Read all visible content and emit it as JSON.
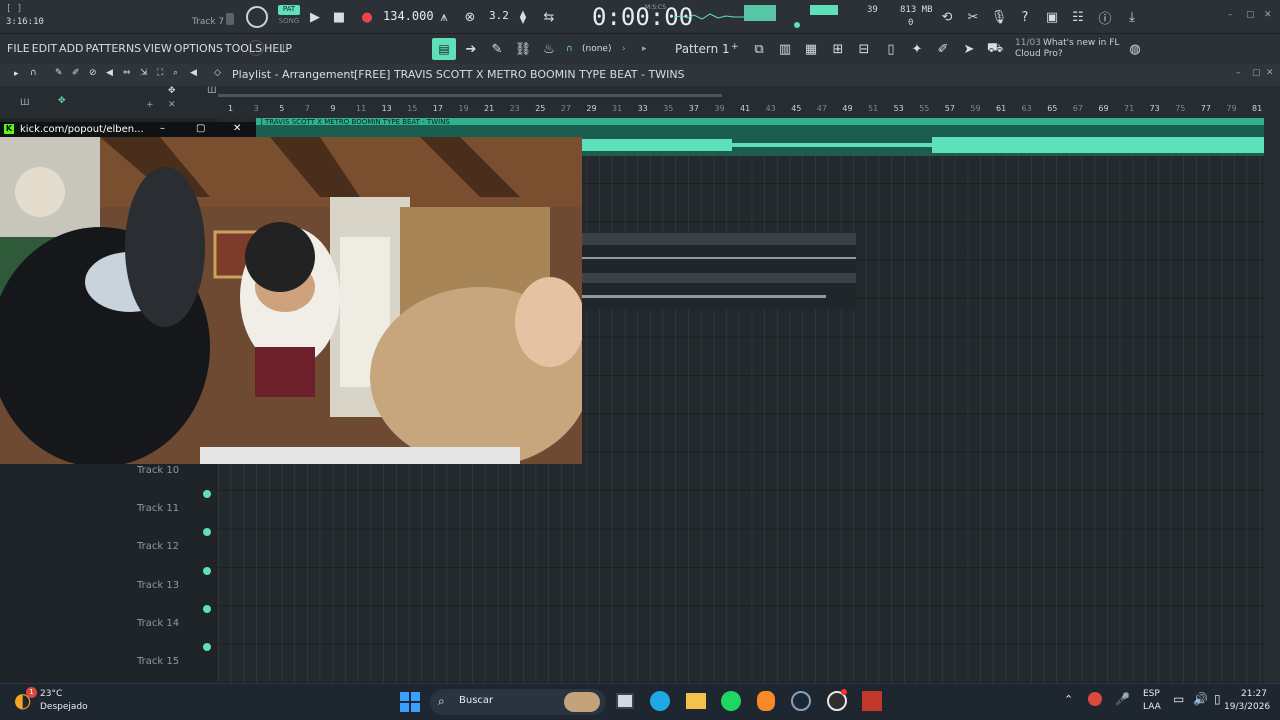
{
  "top": {
    "time_small": "3:16:10",
    "track_name": "Track 7",
    "pat_label": "PAT",
    "song_label": "SONG",
    "tempo": "134.000",
    "step_label": "3.2",
    "clock": "0:00:00",
    "clock_unit": "M:S:CS",
    "cpu": "39",
    "mem": "813 MB",
    "mem2": "0"
  },
  "menu": {
    "items": [
      "FILE",
      "EDIT",
      "ADD",
      "PATTERNS",
      "VIEW",
      "OPTIONS",
      "TOOLS",
      "HELP"
    ],
    "snap": "(none)",
    "pattern": "Pattern 1",
    "news_date": "11/03",
    "news_text": "What's new in FL Cloud Pro?"
  },
  "playlist": {
    "title": "Playlist - Arrangement",
    "project": "[FREE] TRAVIS SCOTT X METRO BOOMIN TYPE BEAT - TWINS",
    "clip_title": "] TRAVIS SCOTT X METRO BOOMIN TYPE BEAT - TWINS"
  },
  "ruler": {
    "ticks": [
      "1",
      "3",
      "5",
      "7",
      "9",
      "11",
      "13",
      "15",
      "17",
      "19",
      "21",
      "23",
      "25",
      "27",
      "29",
      "31",
      "33",
      "35",
      "37",
      "39",
      "41",
      "43",
      "45",
      "47",
      "49",
      "51",
      "53",
      "55",
      "57",
      "59",
      "61",
      "63",
      "65",
      "67",
      "69",
      "71",
      "73",
      "75",
      "77",
      "79",
      "81"
    ]
  },
  "tracks": [
    "Track 10",
    "Track 11",
    "Track 12",
    "Track 13",
    "Track 14",
    "Track 15"
  ],
  "popout": {
    "url": "kick.com/popout/elben..."
  },
  "taskbar": {
    "temp": "23°C",
    "weather": "Despejado",
    "search": "Buscar",
    "lang1": "ESP",
    "lang2": "LAA",
    "time": "21:27",
    "date": "19/3/2026",
    "weather_badge": "1"
  },
  "colors": {
    "accent": "#5ee0b8",
    "clip": "#2fb08f"
  }
}
